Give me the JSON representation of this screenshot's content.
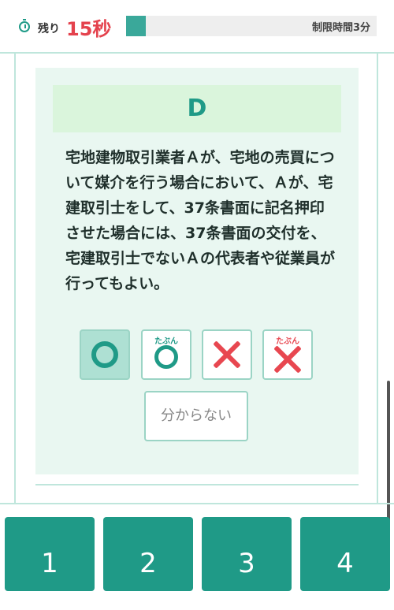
{
  "timer": {
    "remaining_label": "残り",
    "remaining_value": "15秒",
    "remaining_fraction": 0.08,
    "limit_label": "制限時間3分"
  },
  "question": {
    "label": "D",
    "text": "宅地建物取引業者Ａが、宅地の売買について媒介を行う場合において、Ａが、宅建取引士をして、37条書面に記名押印させた場合には、37条書面の交付を、宅建取引士でないＡの代表者や従業員が行ってもよい。"
  },
  "answer_options": [
    {
      "id": "maru",
      "small_text": "",
      "mark": "circle",
      "selected": true
    },
    {
      "id": "tabun-maru",
      "small_text": "たぶん",
      "mark": "circle",
      "selected": false
    },
    {
      "id": "batsu",
      "small_text": "",
      "mark": "cross",
      "selected": false
    },
    {
      "id": "tabun-batsu",
      "small_text": "たぶん",
      "mark": "cross",
      "selected": false
    }
  ],
  "unknown_label": "分からない",
  "choices": [
    "1",
    "2",
    "3",
    "4"
  ],
  "colors": {
    "accent": "#1f9a87",
    "time_red": "#e4424d",
    "cross_red": "#e84750",
    "card_bg": "#e9f7f1",
    "label_bg": "#daf5dc"
  }
}
